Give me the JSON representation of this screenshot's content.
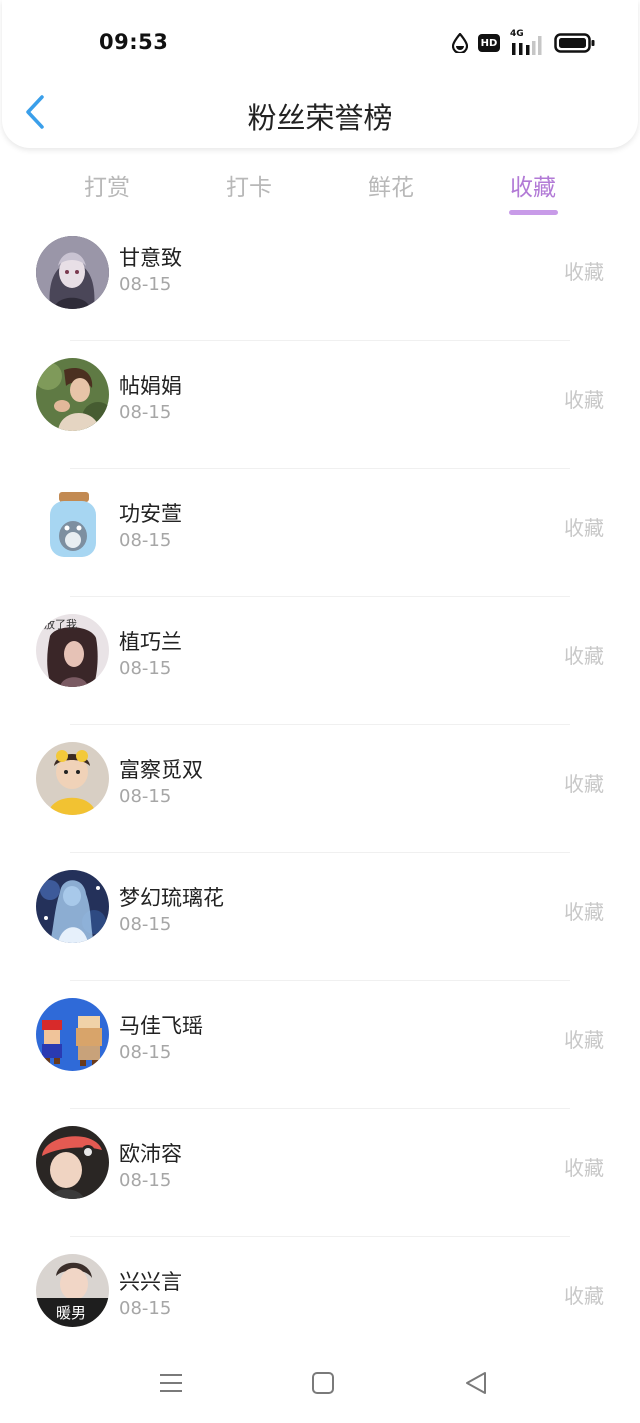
{
  "status_bar": {
    "time": "09:53",
    "hd_badge": "HD",
    "network": "4G",
    "icons": [
      "drop-icon",
      "hd-icon",
      "signal-icon",
      "battery-icon"
    ]
  },
  "header": {
    "title": "粉丝荣誉榜",
    "back_icon": "chevron-left-icon"
  },
  "tabs": [
    {
      "label": "打赏",
      "active": false
    },
    {
      "label": "打卡",
      "active": false
    },
    {
      "label": "鲜花",
      "active": false
    },
    {
      "label": "收藏",
      "active": true
    }
  ],
  "fans": [
    {
      "name": "甘意致",
      "date": "08-15",
      "action": "收藏"
    },
    {
      "name": "帖娟娟",
      "date": "08-15",
      "action": "收藏"
    },
    {
      "name": "功安萱",
      "date": "08-15",
      "action": "收藏"
    },
    {
      "name": "植巧兰",
      "date": "08-15",
      "action": "收藏"
    },
    {
      "name": "富察觅双",
      "date": "08-15",
      "action": "收藏"
    },
    {
      "name": "梦幻琉璃花",
      "date": "08-15",
      "action": "收藏"
    },
    {
      "name": "马佳飞瑶",
      "date": "08-15",
      "action": "收藏"
    },
    {
      "name": "欧沛容",
      "date": "08-15",
      "action": "收藏"
    },
    {
      "name": "兴兴言",
      "date": "08-15",
      "action": "收藏"
    }
  ],
  "avatar_texts": [
    "放了我",
    "暖男"
  ],
  "colors": {
    "accent": "#b27ad6",
    "indicator": "#c89be8",
    "back_arrow": "#3a9fea",
    "inactive_tab": "#b8b8b8",
    "muted": "#a6a6a6"
  },
  "bottom_nav": [
    "menu-icon",
    "home-square-icon",
    "back-triangle-icon"
  ]
}
